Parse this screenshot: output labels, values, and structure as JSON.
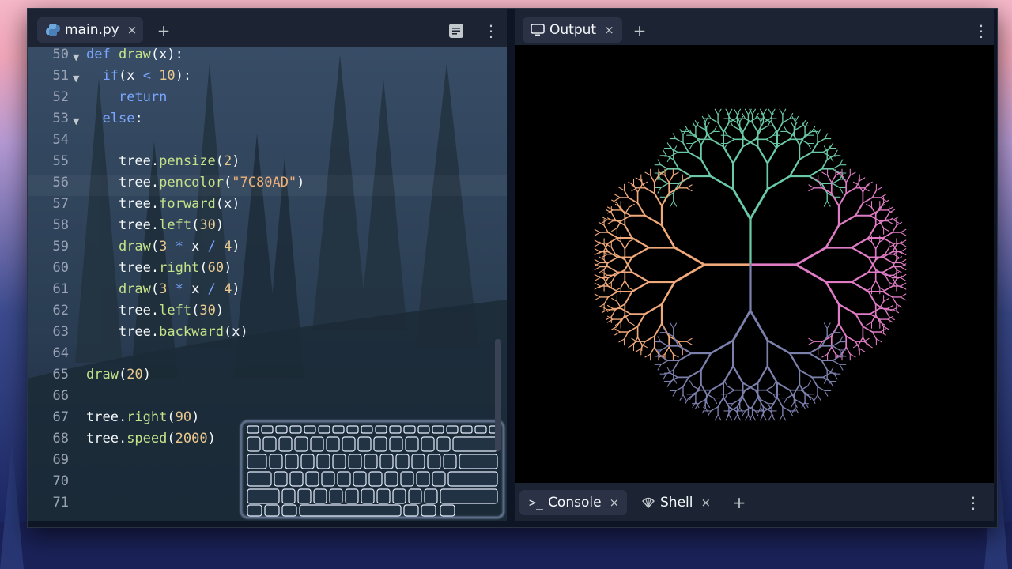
{
  "editor": {
    "tab": {
      "icon": "python-icon",
      "label": "main.py",
      "close": "×"
    },
    "new_tab": "+",
    "toolbar": {
      "format_icon": "format-icon",
      "menu": "⋮"
    },
    "lines": [
      {
        "n": "50",
        "fold": true
      },
      {
        "n": "51",
        "fold": true
      },
      {
        "n": "52"
      },
      {
        "n": "53",
        "fold": true
      },
      {
        "n": "54"
      },
      {
        "n": "55"
      },
      {
        "n": "56"
      },
      {
        "n": "57"
      },
      {
        "n": "58"
      },
      {
        "n": "59"
      },
      {
        "n": "60"
      },
      {
        "n": "61"
      },
      {
        "n": "62"
      },
      {
        "n": "63"
      },
      {
        "n": "64"
      },
      {
        "n": "65"
      },
      {
        "n": "66"
      },
      {
        "n": "67"
      },
      {
        "n": "68"
      },
      {
        "n": "69"
      },
      {
        "n": "70"
      },
      {
        "n": "71"
      }
    ],
    "code": {
      "l50": {
        "kw": "def",
        "fn": "draw",
        "rest": "(x):"
      },
      "l51": {
        "kw": "if",
        "a": "(x ",
        "op": "<",
        "num": "10",
        "b": "):"
      },
      "l52": {
        "kw": "return"
      },
      "l53": {
        "kw": "else",
        "b": ":"
      },
      "l55": {
        "obj": "tree.",
        "fn": "pensize",
        "a": "(",
        "num": "2",
        "b": ")"
      },
      "l56": {
        "obj": "tree.",
        "fn": "pencolor",
        "a": "(",
        "str": "\"7C80AD\"",
        "b": ")"
      },
      "l57": {
        "obj": "tree.",
        "fn": "forward",
        "a": "(x)"
      },
      "l58": {
        "obj": "tree.",
        "fn": "left",
        "a": "(",
        "num": "30",
        "b": ")"
      },
      "l59": {
        "fn": "draw",
        "a": "(",
        "num": "3",
        "op": " * ",
        "x": "x",
        "op2": " / ",
        "num2": "4",
        "b": ")"
      },
      "l60": {
        "obj": "tree.",
        "fn": "right",
        "a": "(",
        "num": "60",
        "b": ")"
      },
      "l61": {
        "fn": "draw",
        "a": "(",
        "num": "3",
        "op": " * ",
        "x": "x",
        "op2": " / ",
        "num2": "4",
        "b": ")"
      },
      "l62": {
        "obj": "tree.",
        "fn": "left",
        "a": "(",
        "num": "30",
        "b": ")"
      },
      "l63": {
        "obj": "tree.",
        "fn": "backward",
        "a": "(x)"
      },
      "l65": {
        "fn": "draw",
        "a": "(",
        "num": "20",
        "b": ")"
      },
      "l67": {
        "obj": "tree.",
        "fn": "right",
        "a": "(",
        "num": "90",
        "b": ")"
      },
      "l68": {
        "obj": "tree.",
        "fn": "speed",
        "a": "(",
        "num": "2000",
        "b": ")"
      }
    }
  },
  "output": {
    "tab": {
      "icon": "monitor-icon",
      "label": "Output",
      "close": "×"
    },
    "new_tab": "+",
    "menu": "⋮",
    "tree_colors": {
      "top": "#6ac9a6",
      "left": "#f0a97a",
      "right": "#e07cc5",
      "bottom": "#7c80ad"
    }
  },
  "console": {
    "tabs": [
      {
        "icon": "terminal-icon",
        "label": "Console",
        "close": "×",
        "active": true
      },
      {
        "icon": "shell-icon",
        "label": "Shell",
        "close": "×",
        "active": false
      }
    ],
    "new_tab": "+",
    "menu": "⋮"
  }
}
